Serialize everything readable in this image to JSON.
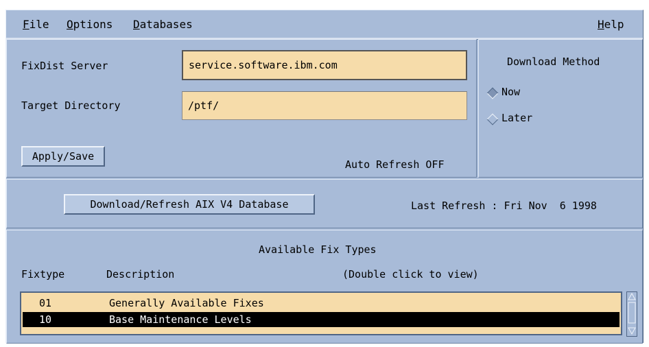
{
  "menu": {
    "file": "File",
    "options": "Options",
    "databases": "Databases",
    "help": "Help"
  },
  "server": {
    "label": "FixDist Server",
    "value": "service.software.ibm.com",
    "target_label": "Target Directory",
    "target_value": "/ptf/",
    "apply_button": "Apply/Save",
    "auto_refresh": "Auto Refresh OFF"
  },
  "download": {
    "title": "Download Method",
    "options": [
      "Now",
      "Later"
    ],
    "selected": "Now"
  },
  "refresh": {
    "button": "Download/Refresh AIX V4 Database",
    "last_refresh": "Last Refresh : Fri Nov  6 1998"
  },
  "fixes": {
    "title": "Available Fix Types",
    "col_fixtype": "Fixtype",
    "col_description": "Description",
    "hint": "(Double click to view)",
    "rows": [
      {
        "code": "01",
        "desc": "Generally Available Fixes",
        "selected": false
      },
      {
        "code": "10",
        "desc": "Base Maintenance Levels",
        "selected": true
      }
    ]
  },
  "colors": {
    "window": "#a8bbd8",
    "field": "#f6dcaa",
    "selection": "#000000"
  }
}
